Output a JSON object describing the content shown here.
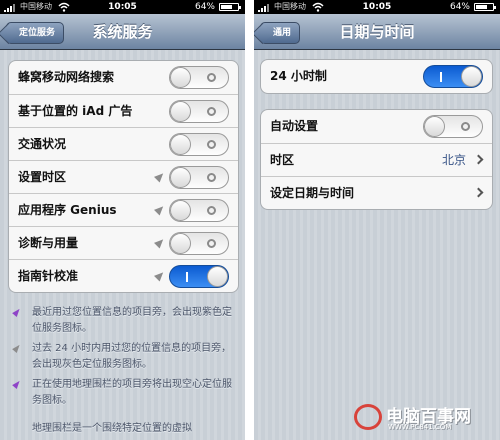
{
  "left": {
    "status": {
      "carrier": "中国移动",
      "time": "10:05",
      "battery": "64%"
    },
    "nav": {
      "back": "定位服务",
      "title": "系统服务"
    },
    "rows": [
      {
        "label": "蜂窝移动网络搜索",
        "toggle": "off",
        "arrow": ""
      },
      {
        "label": "基于位置的 iAd 广告",
        "toggle": "off",
        "arrow": ""
      },
      {
        "label": "交通状况",
        "toggle": "off",
        "arrow": ""
      },
      {
        "label": "设置时区",
        "toggle": "off",
        "arrow": "gray"
      },
      {
        "label": "应用程序 Genius",
        "toggle": "off",
        "arrow": "gray"
      },
      {
        "label": "诊断与用量",
        "toggle": "off",
        "arrow": "gray"
      },
      {
        "label": "指南针校准",
        "toggle": "on",
        "arrow": "gray"
      }
    ],
    "notes": [
      "最近用过您位置信息的项目旁，会出现紫色定位服务图标。",
      "过去 24 小时内用过您的位置信息的项目旁，会出现灰色定位服务图标。",
      "正在使用地理围栏的项目旁将出现空心定位服务图标。",
      "地理围栏是一个围绕特定位置的虚拟"
    ]
  },
  "right": {
    "status": {
      "carrier": "中国移动",
      "time": "10:05",
      "battery": "64%"
    },
    "nav": {
      "back": "通用",
      "title": "日期与时间"
    },
    "group1": [
      {
        "label": "24 小时制",
        "toggle": "on"
      }
    ],
    "group2": [
      {
        "label": "自动设置",
        "toggle": "off"
      },
      {
        "label": "时区",
        "value": "北京"
      },
      {
        "label": "设定日期与时间",
        "value": ""
      }
    ]
  },
  "watermark": {
    "main": "电脑百事网",
    "url": "WWW.PC841.COM"
  },
  "colors": {
    "toggle_on": "#2a7be6",
    "nav_top": "#b6c3d2",
    "nav_bottom": "#6d84a2",
    "value_text": "#385487"
  }
}
